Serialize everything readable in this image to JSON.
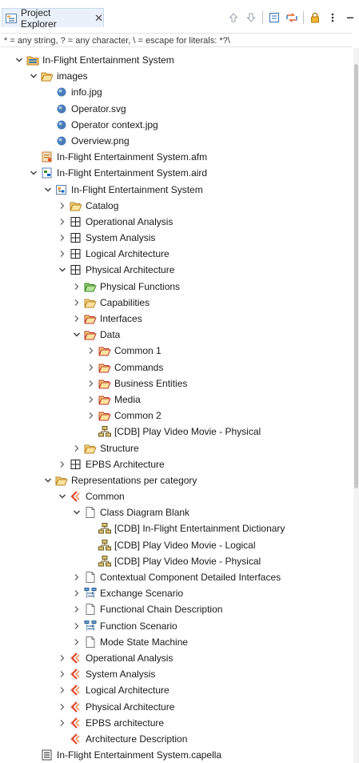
{
  "view": {
    "tab_label": "Project Explorer",
    "close_glyph": "✕",
    "filter_text": "* = any string, ? = any character, \\ = escape for literals: *?\\"
  },
  "toolbar": [
    {
      "name": "back-arrow-icon",
      "icon": "arrow-up"
    },
    {
      "name": "forward-arrow-icon",
      "icon": "arrow-down"
    },
    {
      "sep": true
    },
    {
      "name": "collapse-all-icon",
      "icon": "collapse"
    },
    {
      "name": "link-with-editor-icon",
      "icon": "link"
    },
    {
      "sep": true
    },
    {
      "name": "lock-icon",
      "icon": "lock"
    },
    {
      "name": "view-menu-icon",
      "icon": "kebab"
    },
    {
      "name": "minimize-icon",
      "icon": "minimize"
    },
    {
      "name": "maximize-icon",
      "icon": "maximize"
    }
  ],
  "colors": {
    "accent": "#0a64c8",
    "folder": "#e8a13a",
    "capella": "#e04a2c"
  },
  "tree": [
    {
      "d": 0,
      "t": "down",
      "i": "project",
      "label": "In-Flight Entertainment System"
    },
    {
      "d": 1,
      "t": "down",
      "i": "folder-open",
      "label": "images"
    },
    {
      "d": 2,
      "t": "none",
      "i": "image",
      "label": "info.jpg"
    },
    {
      "d": 2,
      "t": "none",
      "i": "image",
      "label": "Operator.svg"
    },
    {
      "d": 2,
      "t": "none",
      "i": "image",
      "label": "Operator context.jpg"
    },
    {
      "d": 2,
      "t": "none",
      "i": "image",
      "label": "Overview.png"
    },
    {
      "d": 1,
      "t": "none",
      "i": "afm",
      "label": "In-Flight Entertainment System.afm"
    },
    {
      "d": 1,
      "t": "down",
      "i": "aird",
      "label": "In-Flight Entertainment System.aird"
    },
    {
      "d": 2,
      "t": "down",
      "i": "model",
      "label": "In-Flight Entertainment System"
    },
    {
      "d": 3,
      "t": "right",
      "i": "folder-open",
      "label": "Catalog"
    },
    {
      "d": 3,
      "t": "right",
      "i": "grid",
      "label": "Operational Analysis"
    },
    {
      "d": 3,
      "t": "right",
      "i": "grid",
      "label": "System Analysis"
    },
    {
      "d": 3,
      "t": "right",
      "i": "grid",
      "label": "Logical Architecture"
    },
    {
      "d": 3,
      "t": "down",
      "i": "grid",
      "label": "Physical Architecture"
    },
    {
      "d": 4,
      "t": "right",
      "i": "folder-green",
      "label": "Physical Functions"
    },
    {
      "d": 4,
      "t": "right",
      "i": "folder-open",
      "label": "Capabilities"
    },
    {
      "d": 4,
      "t": "right",
      "i": "folder-red",
      "label": "Interfaces"
    },
    {
      "d": 4,
      "t": "down",
      "i": "folder-red",
      "label": "Data"
    },
    {
      "d": 5,
      "t": "right",
      "i": "folder-red",
      "label": "Common 1"
    },
    {
      "d": 5,
      "t": "right",
      "i": "folder-red",
      "label": "Commands"
    },
    {
      "d": 5,
      "t": "right",
      "i": "folder-red",
      "label": "Business Entities"
    },
    {
      "d": 5,
      "t": "right",
      "i": "folder-red",
      "label": "Media"
    },
    {
      "d": 5,
      "t": "right",
      "i": "folder-red",
      "label": "Common 2"
    },
    {
      "d": 5,
      "t": "none",
      "i": "cdb",
      "label": "[CDB] Play Video Movie - Physical"
    },
    {
      "d": 4,
      "t": "right",
      "i": "folder-open",
      "label": "Structure"
    },
    {
      "d": 3,
      "t": "right",
      "i": "grid",
      "label": "EPBS Architecture"
    },
    {
      "d": 2,
      "t": "down",
      "i": "folder-open",
      "label": "Representations per category"
    },
    {
      "d": 3,
      "t": "down",
      "i": "capella",
      "label": "Common"
    },
    {
      "d": 4,
      "t": "down",
      "i": "page",
      "label": "Class Diagram Blank"
    },
    {
      "d": 5,
      "t": "none",
      "i": "cdb",
      "label": "[CDB] In-Flight Entertainment Dictionary"
    },
    {
      "d": 5,
      "t": "none",
      "i": "cdb",
      "label": "[CDB] Play Video Movie - Logical"
    },
    {
      "d": 5,
      "t": "none",
      "i": "cdb",
      "label": "[CDB] Play Video Movie - Physical"
    },
    {
      "d": 4,
      "t": "right",
      "i": "page",
      "label": "Contextual Component Detailed Interfaces"
    },
    {
      "d": 4,
      "t": "right",
      "i": "scenario",
      "label": "Exchange Scenario"
    },
    {
      "d": 4,
      "t": "right",
      "i": "page",
      "label": "Functional Chain Description"
    },
    {
      "d": 4,
      "t": "right",
      "i": "scenario",
      "label": "Function Scenario"
    },
    {
      "d": 4,
      "t": "right",
      "i": "page",
      "label": "Mode State Machine"
    },
    {
      "d": 3,
      "t": "right",
      "i": "capella",
      "label": "Operational Analysis"
    },
    {
      "d": 3,
      "t": "right",
      "i": "capella",
      "label": "System Analysis"
    },
    {
      "d": 3,
      "t": "right",
      "i": "capella",
      "label": "Logical Architecture"
    },
    {
      "d": 3,
      "t": "right",
      "i": "capella",
      "label": "Physical Architecture"
    },
    {
      "d": 3,
      "t": "right",
      "i": "capella",
      "label": "EPBS architecture"
    },
    {
      "d": 3,
      "t": "none",
      "i": "capella",
      "label": "Architecture Description"
    },
    {
      "d": 1,
      "t": "none",
      "i": "capella-file",
      "label": "In-Flight Entertainment System.capella"
    }
  ]
}
